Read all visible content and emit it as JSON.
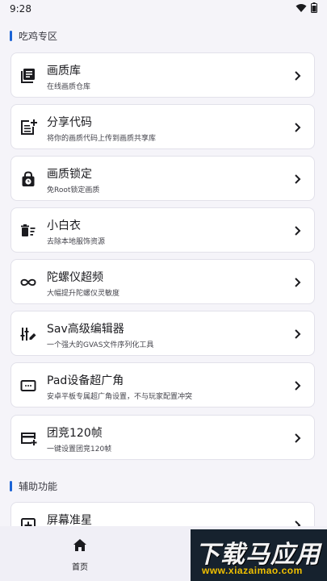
{
  "status": {
    "time": "9:28"
  },
  "sections": [
    {
      "title": "吃鸡专区"
    },
    {
      "title": "辅助功能"
    }
  ],
  "cards": [
    {
      "title": "画质库",
      "desc": "在线画质仓库",
      "icon": "library-icon"
    },
    {
      "title": "分享代码",
      "desc": "将你的画质代码上传到画质共享库",
      "icon": "post-add-icon"
    },
    {
      "title": "画质锁定",
      "desc": "免Root锁定画质",
      "icon": "lock-clock-icon"
    },
    {
      "title": "小白衣",
      "desc": "去除本地服饰资源",
      "icon": "delete-sweep-icon"
    },
    {
      "title": "陀螺仪超频",
      "desc": "大幅提升陀螺仪灵敏度",
      "icon": "infinity-icon"
    },
    {
      "title": "Sav高级编辑器",
      "desc": "一个强大的GVAS文件序列化工具",
      "icon": "edit-tool-icon"
    },
    {
      "title": "Pad设备超广角",
      "desc": "安卓平板专属超广角设置，不与玩家配置冲突",
      "icon": "tablet-dots-icon"
    },
    {
      "title": "团竞120帧",
      "desc": "一键设置团竞120帧",
      "icon": "card-add-icon"
    },
    {
      "title": "屏幕准星",
      "desc": "",
      "icon": "crosshair-box-icon"
    }
  ],
  "nav": {
    "home_label": "首页"
  },
  "watermark": {
    "text": "下载马应用",
    "url": "www.xiazaimao.com"
  },
  "colors": {
    "accent": "#1b63d6",
    "background": "#f5f4f9",
    "card": "#ffffff"
  }
}
